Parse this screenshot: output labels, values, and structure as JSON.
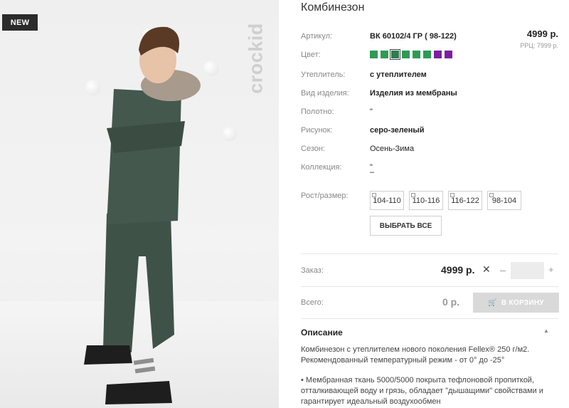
{
  "photo": {
    "badge": "NEW",
    "brand": "crockid"
  },
  "product": {
    "title": "Комбинезон",
    "price": "4999 р.",
    "rrc": "РРЦ: 7999 р.",
    "attributes": [
      {
        "label": "Артикул:",
        "value": "ВК 60102/4 ГР ( 98-122)"
      },
      {
        "label": "Цвет:",
        "value": ""
      },
      {
        "label": "Утеплитель:",
        "value": "с утеплителем"
      },
      {
        "label": "Вид изделия:",
        "value": "Изделия из мембраны"
      },
      {
        "label": "Полотно:",
        "value": "\""
      },
      {
        "label": "Рисунок:",
        "value": "серо-зеленый"
      },
      {
        "label": "Сезон:",
        "value": "Осень-Зима"
      },
      {
        "label": "Коллекция:",
        "value": "\""
      },
      {
        "label": "",
        "value": "–"
      }
    ],
    "colors": [
      "#2e9a55",
      "#2e9a55",
      "#2e9a55",
      "#2e9a55",
      "#2e9a55",
      "#2e9a55",
      "#7b1fa2",
      "#7b1fa2"
    ],
    "size_label": "Рост/размер:",
    "sizes": [
      "104-110",
      "110-116",
      "116-122",
      "98-104"
    ],
    "select_all": "ВЫБРАТЬ ВСЕ"
  },
  "order": {
    "label": "Заказ:",
    "price": "4999 р.",
    "times": "✕",
    "minus": "–",
    "plus": "+",
    "qty": ""
  },
  "total": {
    "label": "Всего:",
    "value": "0 р.",
    "cart_button": "В КОРЗИНУ"
  },
  "description": {
    "title": "Описание",
    "p1": "Комбинезон с утеплителем нового поколения Fellex® 250 г/м2. Рекомендованный температурный режим - от 0° до -25°",
    "p2": "• Мембранная ткань 5000/5000 покрыта тефлоновой пропиткой, отталкивающей воду и грязь, обладает \"дышащими\" свойствами и гарантирует идеальный воздухообмен"
  }
}
